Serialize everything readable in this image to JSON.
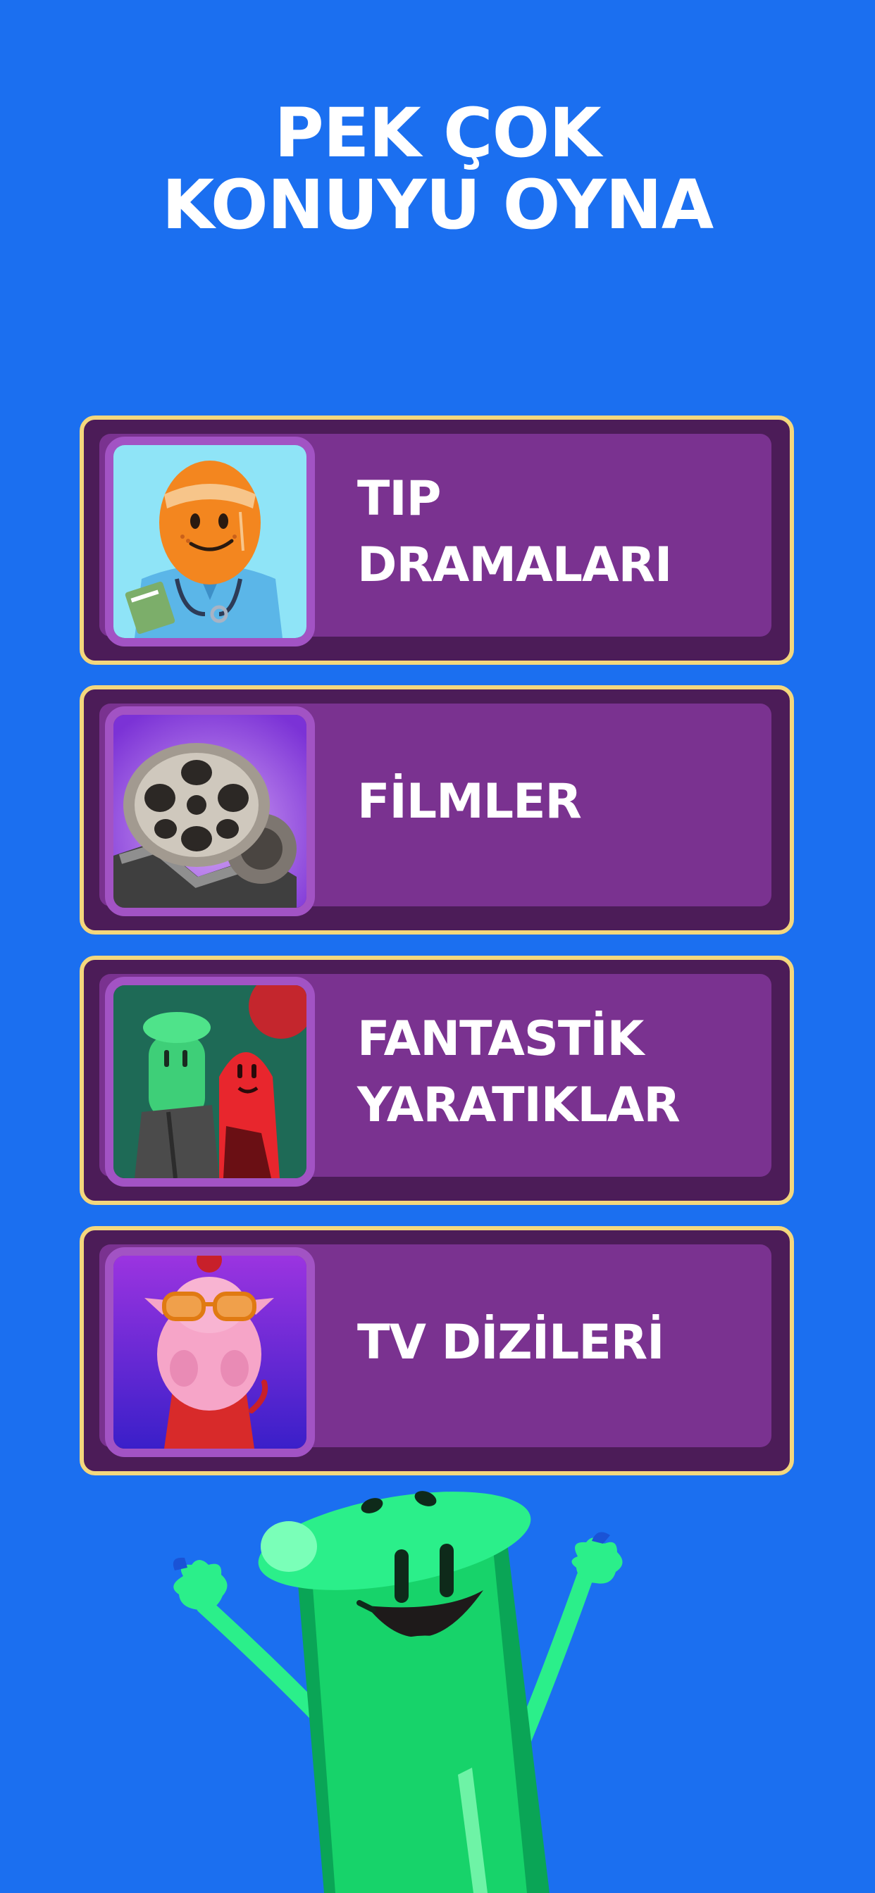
{
  "headline": {
    "line1": "PEK ÇOK",
    "line2": "KONUYU OYNA"
  },
  "categories": [
    {
      "line1": "TIP",
      "line2": "DRAMALARI",
      "icon": "doctor-character-icon"
    },
    {
      "line1": "FİLMLER",
      "line2": "",
      "icon": "film-reel-icon"
    },
    {
      "line1": "FANTASTİK",
      "line2": "YARATIKLAR",
      "icon": "monster-characters-icon"
    },
    {
      "line1": "TV DİZİLERİ",
      "line2": "",
      "icon": "turkey-character-icon"
    }
  ],
  "colors": {
    "background": "#1b6ff0",
    "card_border": "#f4d77d",
    "card_fill": "#7a3290",
    "mascot": "#17d36a"
  }
}
